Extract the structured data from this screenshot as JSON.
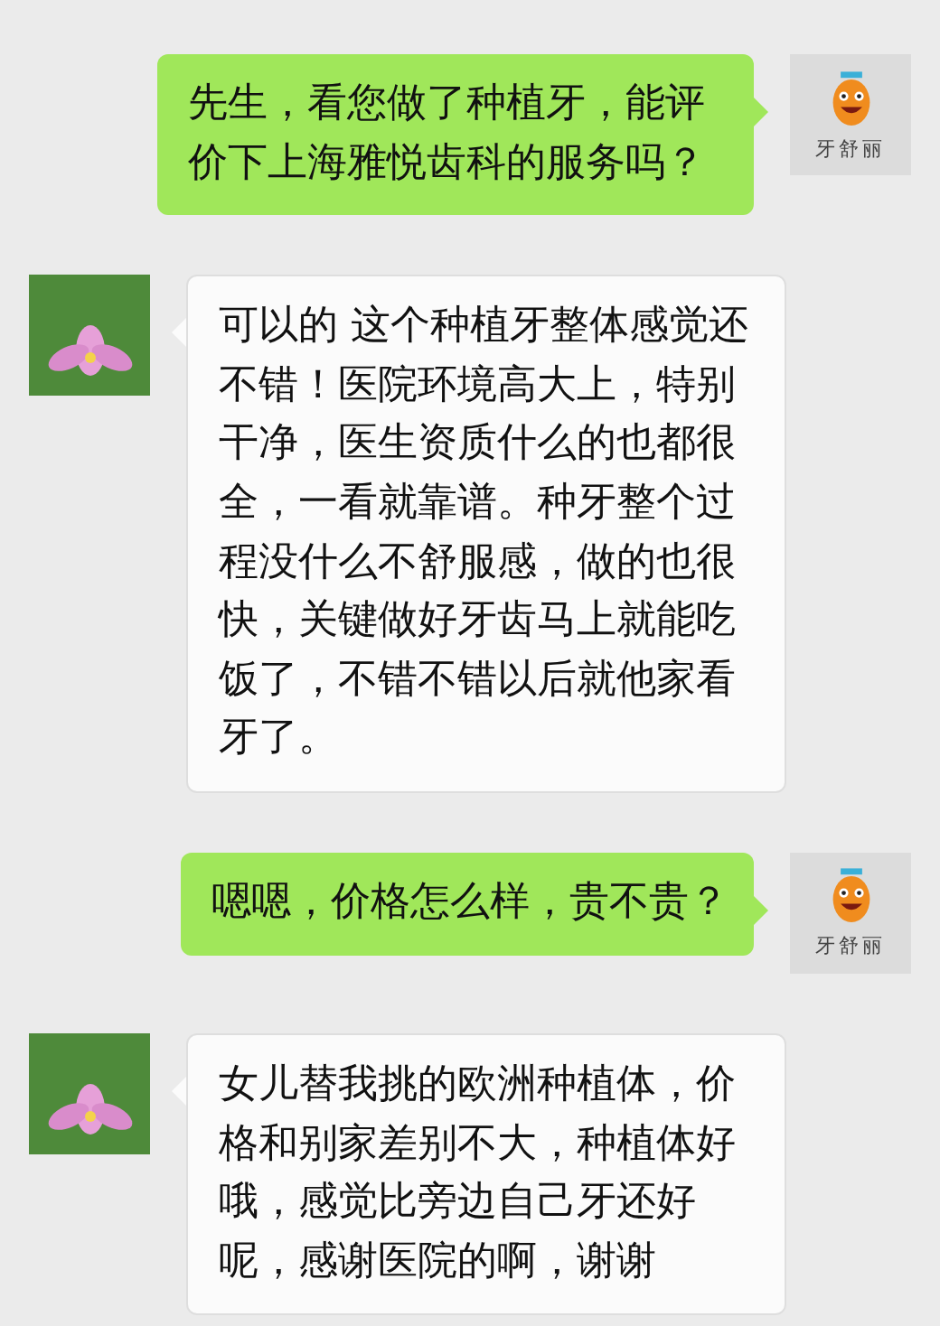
{
  "messages": [
    {
      "kind": "sent",
      "text": "先生，看您做了种植牙，能评价下上海雅悦齿科的服务吗？",
      "avatar_caption": "牙舒丽"
    },
    {
      "kind": "received",
      "text": "可以的 这个种植牙整体感觉还不错！医院环境高大上，特别干净，医生资质什么的也都很全，一看就靠谱。种牙整个过程没什么不舒服感，做的也很快，关键做好牙齿马上就能吃饭了，不错不错以后就他家看牙了。"
    },
    {
      "kind": "sent",
      "text": "嗯嗯，价格怎么样，贵不贵？",
      "avatar_caption": "牙舒丽"
    },
    {
      "kind": "received",
      "text": "女儿替我挑的欧洲种植体，价格和别家差别不大，种植体好哦，感觉比旁边自己牙还好呢，感谢医院的啊，谢谢"
    }
  ]
}
